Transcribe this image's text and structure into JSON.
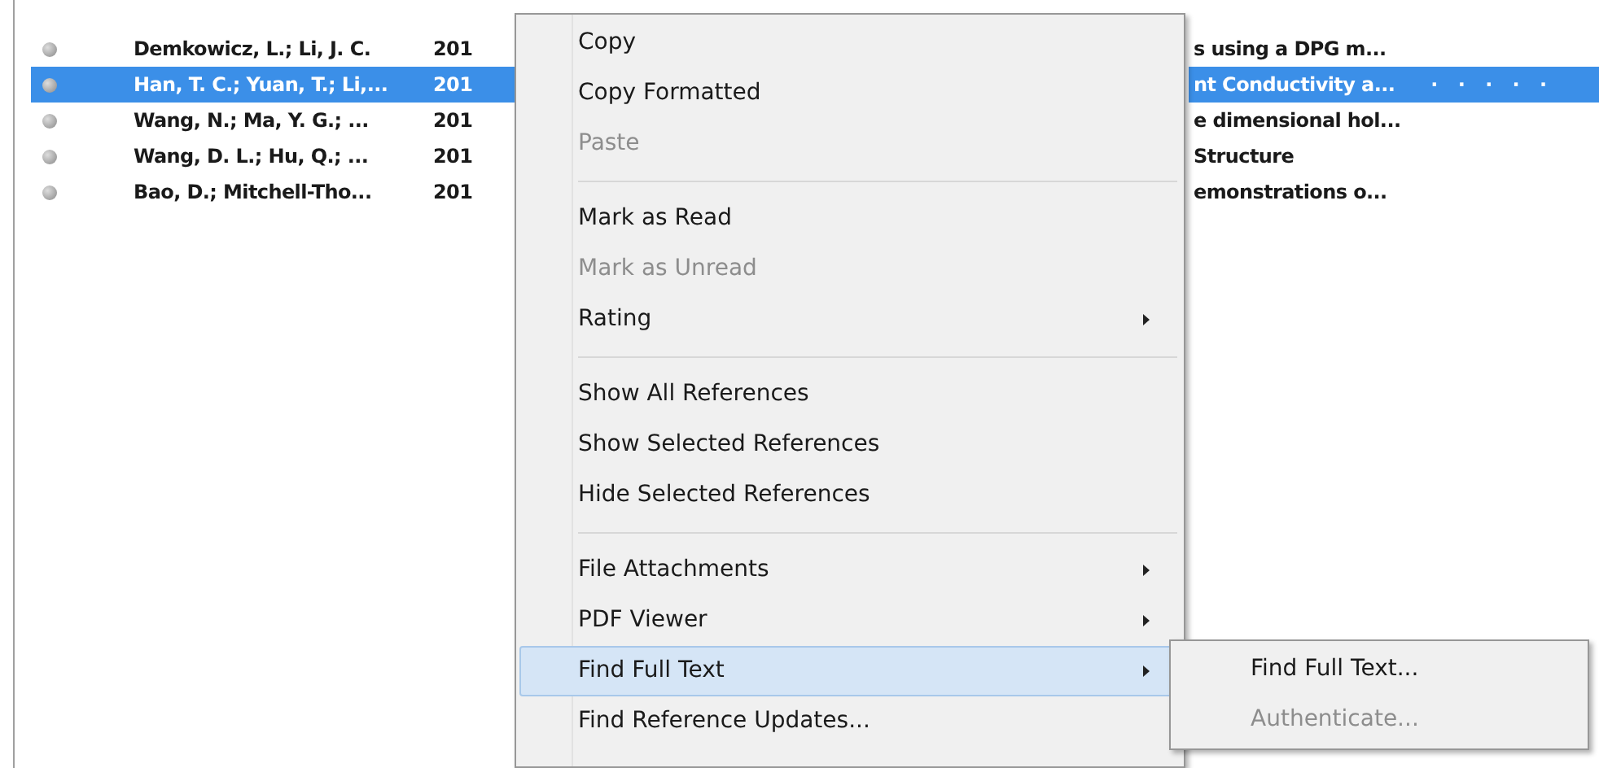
{
  "references": [
    {
      "author": "Demkowicz, L.; Li, J. C.",
      "year": "201",
      "title": "s using a DPG m...",
      "selected": false
    },
    {
      "author": "Han, T. C.; Yuan, T.; Li,...",
      "year": "201",
      "title": "nt Conductivity a...",
      "selected": true,
      "rating": "· · · · ·"
    },
    {
      "author": "Wang, N.; Ma, Y. G.; ...",
      "year": "201",
      "title": "e dimensional hol...",
      "selected": false
    },
    {
      "author": "Wang, D. L.; Hu, Q.; ...",
      "year": "201",
      "title": "Structure",
      "selected": false
    },
    {
      "author": "Bao, D.; Mitchell-Tho...",
      "year": "201",
      "title": "emonstrations o...",
      "selected": false
    }
  ],
  "context_menu": {
    "items": [
      {
        "kind": "item",
        "label": "Copy",
        "disabled": false,
        "submenu": false,
        "selected": false
      },
      {
        "kind": "item",
        "label": "Copy Formatted",
        "disabled": false,
        "submenu": false,
        "selected": false
      },
      {
        "kind": "item",
        "label": "Paste",
        "disabled": true,
        "submenu": false,
        "selected": false
      },
      {
        "kind": "separator"
      },
      {
        "kind": "item",
        "label": "Mark as Read",
        "disabled": false,
        "submenu": false,
        "selected": false
      },
      {
        "kind": "item",
        "label": "Mark as Unread",
        "disabled": true,
        "submenu": false,
        "selected": false
      },
      {
        "kind": "item",
        "label": "Rating",
        "disabled": false,
        "submenu": true,
        "selected": false
      },
      {
        "kind": "separator"
      },
      {
        "kind": "item",
        "label": "Show All References",
        "disabled": false,
        "submenu": false,
        "selected": false
      },
      {
        "kind": "item",
        "label": "Show Selected References",
        "disabled": false,
        "submenu": false,
        "selected": false
      },
      {
        "kind": "item",
        "label": "Hide Selected References",
        "disabled": false,
        "submenu": false,
        "selected": false
      },
      {
        "kind": "separator"
      },
      {
        "kind": "item",
        "label": "File Attachments",
        "disabled": false,
        "submenu": true,
        "selected": false
      },
      {
        "kind": "item",
        "label": "PDF Viewer",
        "disabled": false,
        "submenu": true,
        "selected": false
      },
      {
        "kind": "item",
        "label": "Find Full Text",
        "disabled": false,
        "submenu": true,
        "selected": true
      },
      {
        "kind": "item",
        "label": "Find Reference Updates...",
        "disabled": false,
        "submenu": false,
        "selected": false
      }
    ]
  },
  "submenu": {
    "items": [
      {
        "label": "Find Full Text...",
        "disabled": false
      },
      {
        "label": "Authenticate...",
        "disabled": true
      }
    ]
  }
}
